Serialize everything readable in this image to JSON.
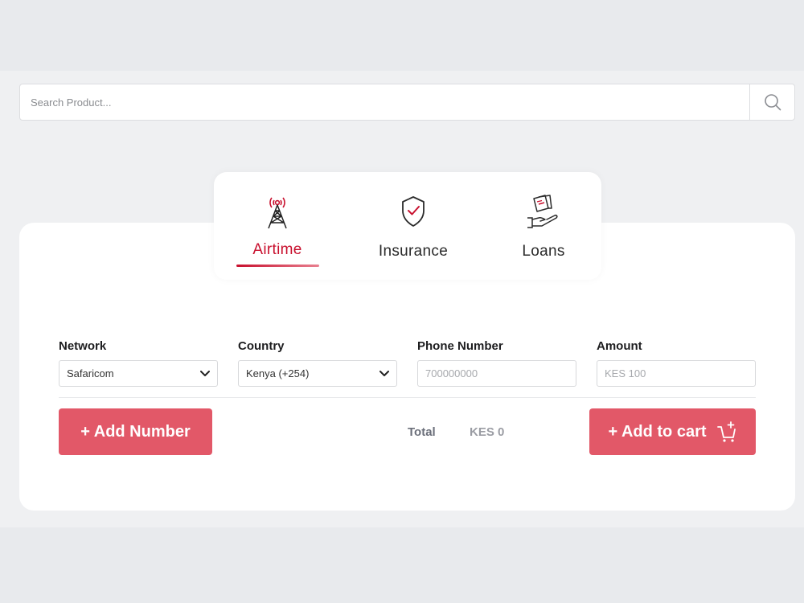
{
  "search": {
    "placeholder": "Search Product..."
  },
  "tabs": [
    {
      "label": "Airtime",
      "icon": "cell-tower-icon",
      "active": true
    },
    {
      "label": "Insurance",
      "icon": "shield-check-icon",
      "active": false
    },
    {
      "label": "Loans",
      "icon": "hand-money-icon",
      "active": false
    }
  ],
  "form": {
    "network": {
      "label": "Network",
      "value": "Safaricom"
    },
    "country": {
      "label": "Country",
      "value": "Kenya (+254)"
    },
    "phone": {
      "label": "Phone Number",
      "placeholder": "700000000"
    },
    "amount": {
      "label": "Amount",
      "placeholder": "KES 100"
    }
  },
  "actions": {
    "add_number": "+ Add Number",
    "add_to_cart": "+ Add to cart"
  },
  "total": {
    "label": "Total",
    "value": "KES 0"
  },
  "colors": {
    "accent": "#c8102e",
    "button": "#e25868",
    "background": "#eff0f2"
  }
}
